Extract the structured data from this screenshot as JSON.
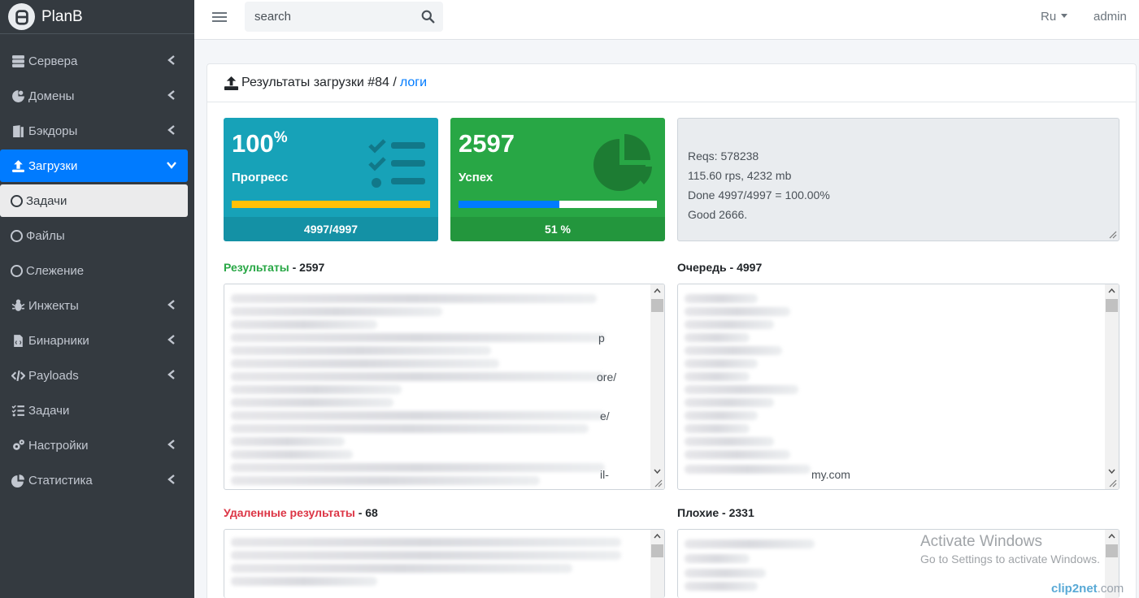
{
  "brand": {
    "name": "PlanB"
  },
  "sidebar": {
    "items": [
      {
        "label": "Сервера",
        "icon": "server-icon"
      },
      {
        "label": "Домены",
        "icon": "domain-icon"
      },
      {
        "label": "Бэкдоры",
        "icon": "door-icon"
      },
      {
        "label": "Загрузки",
        "icon": "upload-icon",
        "active": true
      },
      {
        "label": "Задачи",
        "icon": "circle-icon",
        "sub": true,
        "current": true
      },
      {
        "label": "Файлы",
        "icon": "circle-icon",
        "sub": true
      },
      {
        "label": "Слежение",
        "icon": "circle-icon",
        "sub": true
      },
      {
        "label": "Инжекты",
        "icon": "bug-icon"
      },
      {
        "label": "Бинарники",
        "icon": "file-code-icon"
      },
      {
        "label": "Payloads",
        "icon": "code-icon"
      },
      {
        "label": "Задачи",
        "icon": "tasks-icon"
      },
      {
        "label": "Настройки",
        "icon": "gears-icon"
      },
      {
        "label": "Статистика",
        "icon": "chart-pie-icon"
      }
    ]
  },
  "header": {
    "search_placeholder": "search",
    "lang": "Ru",
    "user": "admin"
  },
  "page": {
    "title": "Результаты загрузки #84 / ",
    "logs_link": "логи"
  },
  "progress_box": {
    "value": "100",
    "unit": "%",
    "label": "Прогресс",
    "footer": "4997/4997",
    "fill": 1.0,
    "bar_color": "#ffc107"
  },
  "success_box": {
    "value": "2597",
    "label": "Успех",
    "footer": "51 %",
    "fill": 0.51,
    "bar_color": "#007bff"
  },
  "stats": {
    "line1": "Reqs: 578238",
    "line2": "115.60 rps, 4232 mb",
    "line3": "Done 4997/4997 = 100.00%",
    "line4": "Good 2666."
  },
  "results": {
    "label": "Результаты",
    "count": " - 2597",
    "tails": [
      "p",
      "ore/",
      "e/",
      "il-"
    ]
  },
  "queue": {
    "label": "Очередь",
    "count": " - 4997",
    "tail": "my.com"
  },
  "deleted": {
    "label": "Удаленные результаты",
    "count": " - 68"
  },
  "bad": {
    "label": "Плохие",
    "count": " - 2331"
  },
  "watermark": {
    "line1": "Activate Windows",
    "line2": "Go to Settings to activate Windows."
  },
  "clip": {
    "brand": "clip2net",
    "suffix": ".com"
  }
}
